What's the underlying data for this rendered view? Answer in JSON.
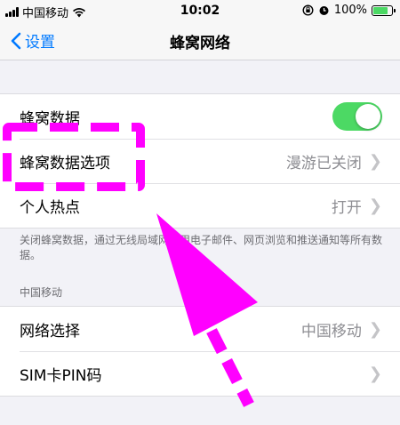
{
  "status": {
    "carrier": "中国移动",
    "time": "10:02",
    "battery": "100%"
  },
  "nav": {
    "back_label": "设置",
    "title": "蜂窝网络"
  },
  "group1": {
    "cellular_data": {
      "label": "蜂窝数据",
      "on": true
    },
    "cellular_options": {
      "label": "蜂窝数据选项",
      "value": "漫游已关闭"
    },
    "hotspot": {
      "label": "个人热点",
      "value": "打开"
    }
  },
  "footer_note": "关闭蜂窝数据，通过无线局域网使用电子邮件、网页浏览和推送通知等所有数据。",
  "section_carrier": "中国移动",
  "group2": {
    "network_select": {
      "label": "网络选择",
      "value": "中国移动"
    },
    "sim_pin": {
      "label": "SIM卡PIN码"
    }
  },
  "colors": {
    "accent": "#007aff",
    "toggle_on": "#4cd964",
    "annotation": "#ff00ff"
  }
}
